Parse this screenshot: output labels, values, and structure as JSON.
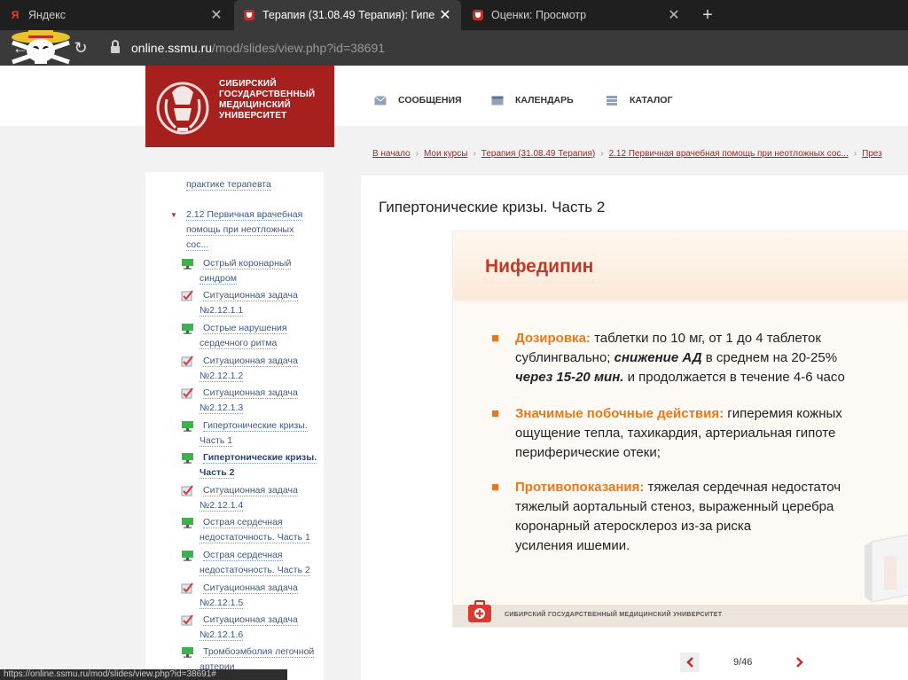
{
  "browser": {
    "tabs": [
      {
        "title": "Яндекс",
        "favicon": "Я"
      },
      {
        "title": "Терапия (31.08.49 Терапия): Гипе",
        "favicon": "ssmu-favicon"
      },
      {
        "title": "Оценки: Просмотр",
        "favicon": "ssmu-favicon"
      }
    ],
    "new_tab": "+",
    "url_host": "online.ssmu.ru",
    "url_path": "/mod/slides/view.php?id=38691",
    "status_url": "https://online.ssmu.ru/mod/slides/view.php?id=38691#"
  },
  "site": {
    "logo_lines": [
      "СИБИРСКИЙ",
      "ГОСУДАРСТВЕННЫЙ",
      "МЕДИЦИНСКИЙ",
      "УНИВЕРСИТЕТ"
    ],
    "nav": [
      "СООБЩЕНИЯ",
      "КАЛЕНДАРЬ",
      "КАТАЛОГ"
    ],
    "breadcrumbs": [
      "В начало",
      "Мои курсы",
      "Терапия (31.08.49 Терапия)",
      "2.12 Первичная врачебная помощь при неотложных сос...",
      "През"
    ],
    "accent": "#a6201e"
  },
  "sidebar": {
    "top_fragment": "практике терапевта",
    "section": [
      "2.12 Первичная врачебная",
      "помощь при неотложных",
      "сос..."
    ],
    "items": [
      {
        "icon": "slides-icon",
        "lines": [
          "Острый коронарный",
          "синдром"
        ]
      },
      {
        "icon": "quiz-icon",
        "lines": [
          "Ситуационная задача",
          "№2.12.1.1"
        ]
      },
      {
        "icon": "slides-icon",
        "lines": [
          "Острые нарушения",
          "сердечного ритма"
        ]
      },
      {
        "icon": "quiz-icon",
        "lines": [
          "Ситуационная задача",
          "№2.12.1.2"
        ]
      },
      {
        "icon": "quiz-icon",
        "lines": [
          "Ситуационная задача",
          "№2.12.1.3"
        ]
      },
      {
        "icon": "slides-icon",
        "lines": [
          "Гипертонические кризы.",
          "Часть 1"
        ]
      },
      {
        "icon": "slides-icon",
        "lines": [
          "Гипертонические кризы.",
          "Часть 2"
        ],
        "current": true
      },
      {
        "icon": "quiz-icon",
        "lines": [
          "Ситуационная задача",
          "№2.12.1.4"
        ]
      },
      {
        "icon": "slides-icon",
        "lines": [
          "Острая сердечная",
          "недостаточность. Часть 1"
        ]
      },
      {
        "icon": "slides-icon",
        "lines": [
          "Острая сердечная",
          "недостаточность. Часть 2"
        ]
      },
      {
        "icon": "quiz-icon",
        "lines": [
          "Ситуационная задача",
          "№2.12.1.5"
        ]
      },
      {
        "icon": "quiz-icon",
        "lines": [
          "Ситуационная задача",
          "№2.12.1.6"
        ]
      },
      {
        "icon": "slides-icon",
        "lines": [
          "Тромбоэмболия легочной",
          "артерии"
        ]
      }
    ]
  },
  "main": {
    "title": "Гипертонические кризы. Часть 2",
    "slide": {
      "heading": "Нифедипин",
      "b1_kw": "Дозировка:",
      "b1_l1": " таблетки по 10 мг, от 1 до 4 таблеток",
      "b1_l2a": "сублингвально; ",
      "b1_l2b": "снижение АД",
      "b1_l2c": " в среднем на 20-25%",
      "b1_l3a": "через 15-20 мин.",
      "b1_l3b": " и продолжается в течение 4-6 часо",
      "b2_kw": "Значимые побочные действия:",
      "b2_l1": " гиперемия кожных",
      "b2_l2": "ощущение тепла, тахикардия, артериальная гипоте",
      "b2_l3": "периферические отеки;",
      "b3_kw": "Противопоказания:",
      "b3_l1": " тяжелая сердечная недостаточ",
      "b3_l2": "тяжелый аортальный стеноз, выраженный церебра",
      "b3_l3": "коронарный атеросклероз из-за риска",
      "b3_l4": "усиления ишемии.",
      "footer": "СИБИРСКИЙ ГОСУДАРСТВЕННЫЙ МЕДИЦИНСКИЙ УНИВЕРСИТЕТ"
    },
    "pager": {
      "count": "9/46"
    }
  }
}
